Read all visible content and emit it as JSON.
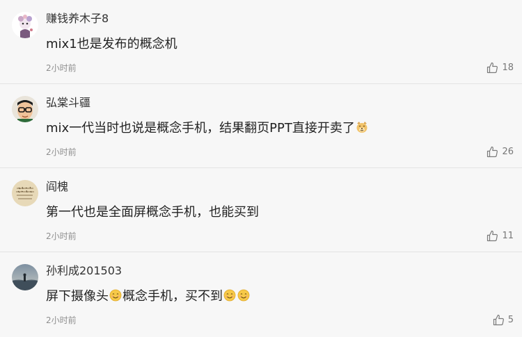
{
  "comments": [
    {
      "username": "赚钱养木子8",
      "text": "mix1也是发布的概念机",
      "time": "2小时前",
      "likes": "18",
      "avatar_icon": "flower-doll-avatar"
    },
    {
      "username": "弘棠斗疆",
      "text": "mix一代当时也说是概念手机，结果翻页PPT直接开卖了",
      "text_suffix_emoji": "laughing-dog-emoji",
      "time": "2小时前",
      "likes": "26",
      "avatar_icon": "glasses-man-avatar"
    },
    {
      "username": "阎槐",
      "text": "第一代也是全面屏概念手机，也能买到",
      "time": "2小时前",
      "likes": "11",
      "avatar_icon": "handwriting-avatar"
    },
    {
      "username": "孙利成201503",
      "text_part1": "屏下摄像头",
      "text_part2": "概念手机，买不到",
      "emoji_name": "smile-emoji",
      "time": "2小时前",
      "likes": "5",
      "avatar_icon": "landscape-avatar"
    }
  ],
  "colors": {
    "background": "#f7f7f7",
    "divider": "#e3e3e3",
    "username": "#333333",
    "body": "#222222",
    "meta": "#8f8f8f"
  }
}
